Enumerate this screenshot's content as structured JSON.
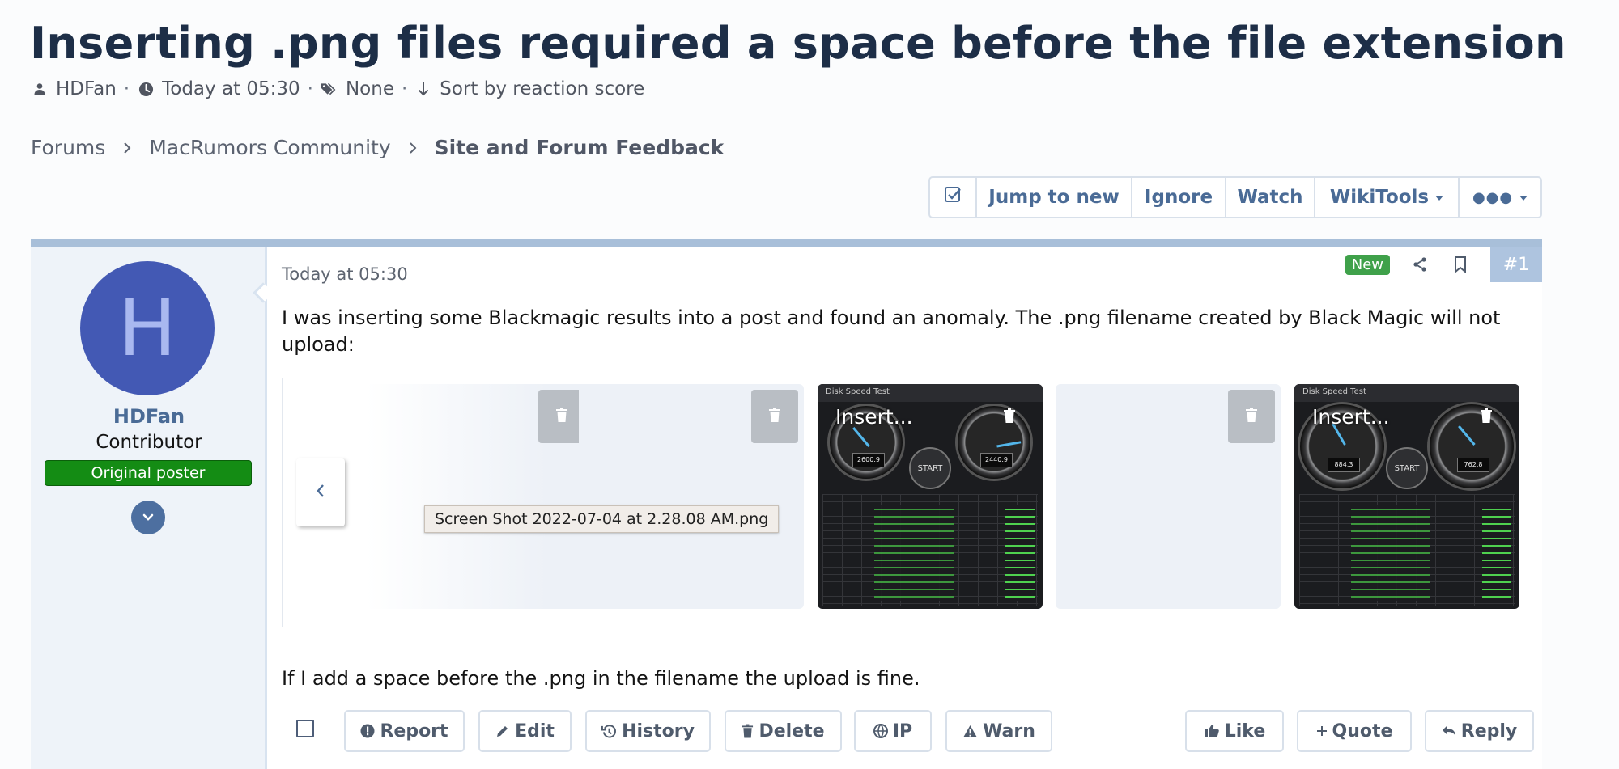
{
  "thread": {
    "title": "Inserting .png files required a space before the file extension",
    "author": "HDFan",
    "time": "Today at 05:30",
    "tags": "None",
    "sort": "Sort by reaction score"
  },
  "breadcrumbs": [
    "Forums",
    "MacRumors Community",
    "Site and Forum Feedback"
  ],
  "toolbar": {
    "jump_to_new": "Jump to new",
    "ignore": "Ignore",
    "watch": "Watch",
    "wikitools": "WikiTools",
    "more": "●●●"
  },
  "post": {
    "user": {
      "initial": "H",
      "name": "HDFan",
      "role": "Contributor",
      "badge": "Original poster"
    },
    "time": "Today at 05:30",
    "new_badge": "New",
    "number": "#1",
    "text1": "I was inserting some Blackmagic results into a post and found an anomaly. The .png filename created by Black Magic will not upload:",
    "text2": "If I add a space before the .png in the filename the upload is fine.",
    "attachments": [
      {
        "caption": ""
      },
      {
        "caption": ""
      },
      {
        "caption": "Insert..."
      },
      {
        "caption": ""
      },
      {
        "caption": "Insert..."
      }
    ],
    "tooltip": "Screen Shot 2022-07-04 at 2.28.08 AM.png",
    "shot_header": "Disk Speed Test",
    "shot1": {
      "write": "2600.9",
      "read": "2440.9",
      "start": "START"
    },
    "shot2": {
      "write": "884.3",
      "read": "762.8",
      "start": "START"
    },
    "actions": {
      "report": "Report",
      "edit": "Edit",
      "history": "History",
      "delete": "Delete",
      "ip": "IP",
      "warn": "Warn",
      "like": "Like",
      "quote": "Quote",
      "reply": "Reply"
    }
  },
  "colors": {
    "title": "#1d2e47",
    "link": "#4a6b96",
    "avatar_bg": "#4359b4",
    "op_badge": "#148c14",
    "new_badge": "#3fa14a",
    "post_number_bg": "#aec4df"
  }
}
